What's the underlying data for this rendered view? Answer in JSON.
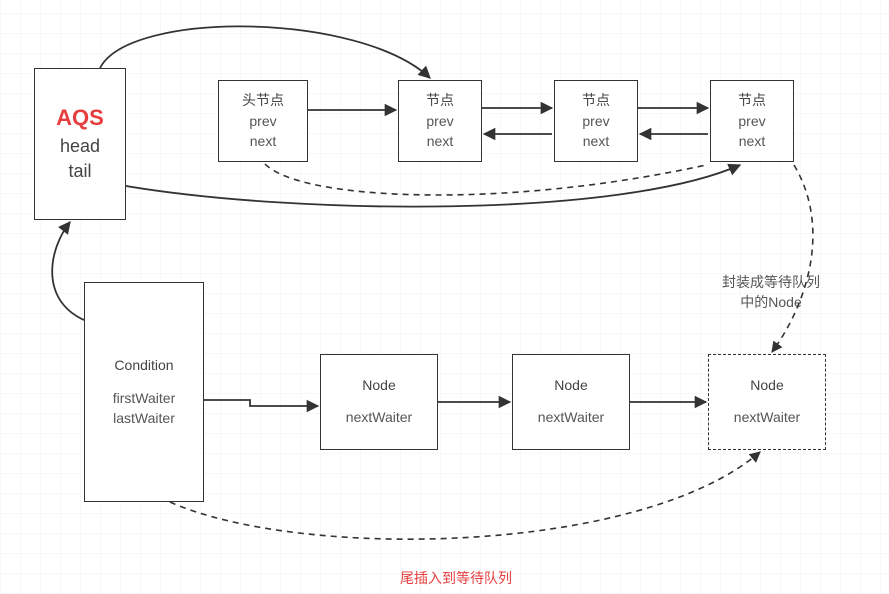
{
  "aqs": {
    "title": "AQS",
    "line1": "head",
    "line2": "tail"
  },
  "syncQueue": {
    "headNode": {
      "title": "头节点",
      "line1": "prev",
      "line2": "next"
    },
    "nodes": [
      {
        "title": "节点",
        "line1": "prev",
        "line2": "next"
      },
      {
        "title": "节点",
        "line1": "prev",
        "line2": "next"
      },
      {
        "title": "节点",
        "line1": "prev",
        "line2": "next"
      }
    ]
  },
  "condition": {
    "title": "Condition",
    "line1": "firstWaiter",
    "line2": "lastWaiter"
  },
  "waitQueue": {
    "nodes": [
      {
        "title": "Node",
        "line1": "nextWaiter"
      },
      {
        "title": "Node",
        "line1": "nextWaiter"
      },
      {
        "title": "Node",
        "line1": "nextWaiter",
        "dashed": true
      }
    ]
  },
  "labels": {
    "wrapNode": "封装成等待队列\n中的Node",
    "tailInsert": "尾插入到等待队列"
  },
  "arrows": {
    "color": "#333",
    "dashColor": "#333"
  }
}
